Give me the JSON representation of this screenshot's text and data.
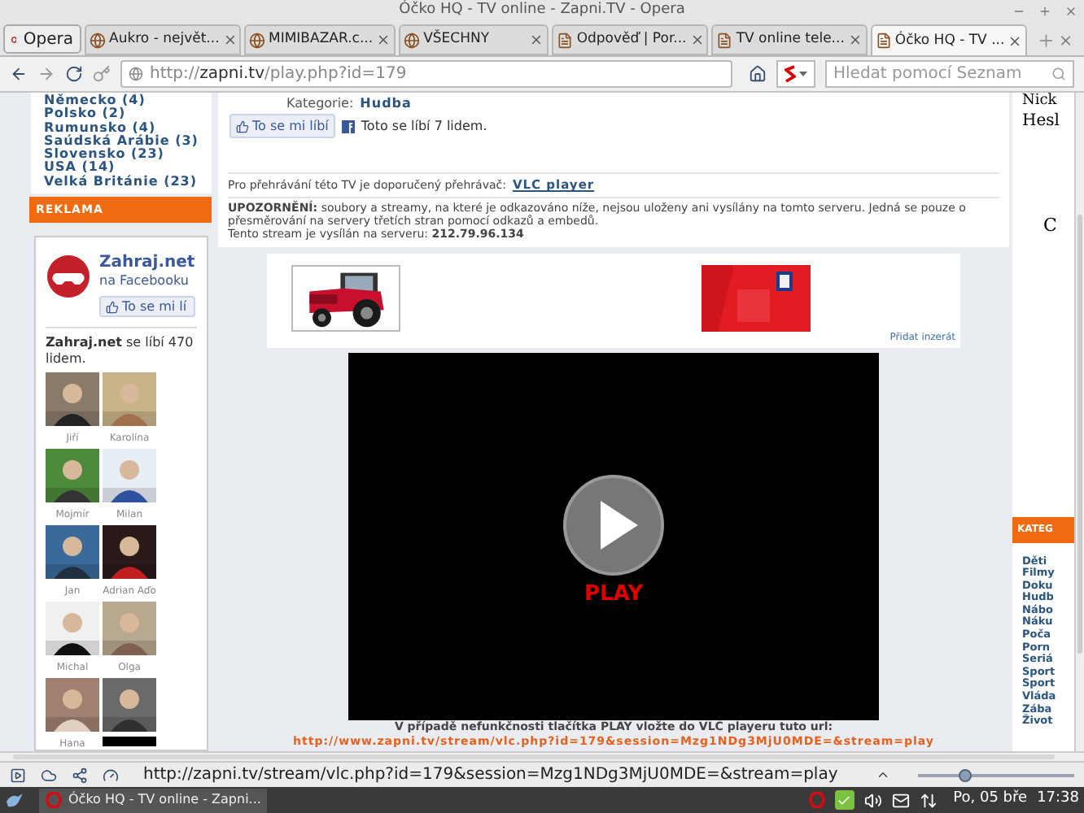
{
  "window": {
    "title": "Óčko HQ - TV online - Zapni.TV - Opera"
  },
  "menu_button": "Opera",
  "tabs": [
    {
      "label": "Aukro - největ...",
      "selected": false
    },
    {
      "label": "MIMIBAZAR.c...",
      "selected": false
    },
    {
      "label": "VŠECHNY",
      "selected": false
    },
    {
      "label": "Odpověď | Por...",
      "selected": false
    },
    {
      "label": "TV online tele...",
      "selected": false
    },
    {
      "label": "Óčko HQ - TV ...",
      "selected": true
    }
  ],
  "address_bar": {
    "url_prefix": "http://",
    "url_host": "zapni.tv",
    "url_path": "/play.php?id=179"
  },
  "search": {
    "placeholder": "Hledat pomocí Seznam"
  },
  "sidebar": {
    "countries": [
      "Německo (4)",
      "Polsko (2)",
      "Rumunsko (4)",
      "Saúdská Arábie (3)",
      "Slovensko (23)",
      "USA (14)",
      "Velká Británie (23)"
    ],
    "ad_heading": "REKLAMA",
    "facebook": {
      "page_name": "Zahraj.net",
      "subtitle": "na Facebooku",
      "like_button": "To se mi lí",
      "likes_text": "**Zahraj.net** se líbí 470 lidem.",
      "friends": [
        {
          "name": "Jiří"
        },
        {
          "name": "Karolína"
        },
        {
          "name": "Mojmír"
        },
        {
          "name": "Milan"
        },
        {
          "name": "Jan"
        },
        {
          "name": "Adrian Aďo"
        },
        {
          "name": "Michal"
        },
        {
          "name": "Olga"
        },
        {
          "name": "Hana"
        },
        {
          "kind": "picture"
        }
      ]
    }
  },
  "main": {
    "category_label": "Kategorie:",
    "category": "Hudba",
    "like_button": "To se mi líbí",
    "like_count": "Toto se líbí 7 lidem.",
    "player_note": "Pro přehrávání této TV je doporučený přehrávač:",
    "player_link": "VLC player",
    "warning": "**UPOZORNĚNÍ:** soubory a streamy, na které je odkazováno níže, nejsou uloženy ani vysílány na tomto serveru. Jedná se pouze o přesměrování na servery třetích stran pomocí odkazů a embedů.",
    "server": "Tento stream je vysílán na serveru: **212.79.96.134**",
    "ad_link": "Přidat inzerát",
    "play_label": "PLAY",
    "fallback_note": "V případě nefunkčnosti tlačítka PLAY vložte do VLC playeru tuto url:",
    "stream_url": "http://www.zapni.tv/stream/vlc.php?id=179&session=Mzg1NDg3MjU0MDE=&stream=play"
  },
  "right_panel": {
    "fields": [
      "Nick",
      "Hesl"
    ],
    "button": "C",
    "heading": "KATEG",
    "categories": [
      "Děti",
      "Filmy",
      "Doku",
      "Hudb",
      "Nábo",
      "Náku",
      "Poča",
      "Porn",
      "Seriá",
      "Sport",
      "Sport",
      "Vláda",
      "Zába",
      "Život"
    ]
  },
  "status_bar": {
    "url": "http://zapni.tv/stream/vlc.php?id=179&session=Mzg1NDg3MjU0MDE=&stream=play",
    "zoom": {
      "level": 0.3
    }
  },
  "taskbar": {
    "task": "Óčko HQ - TV online - Zapni...",
    "date": "Po, 05 bře",
    "time": "17:38"
  }
}
